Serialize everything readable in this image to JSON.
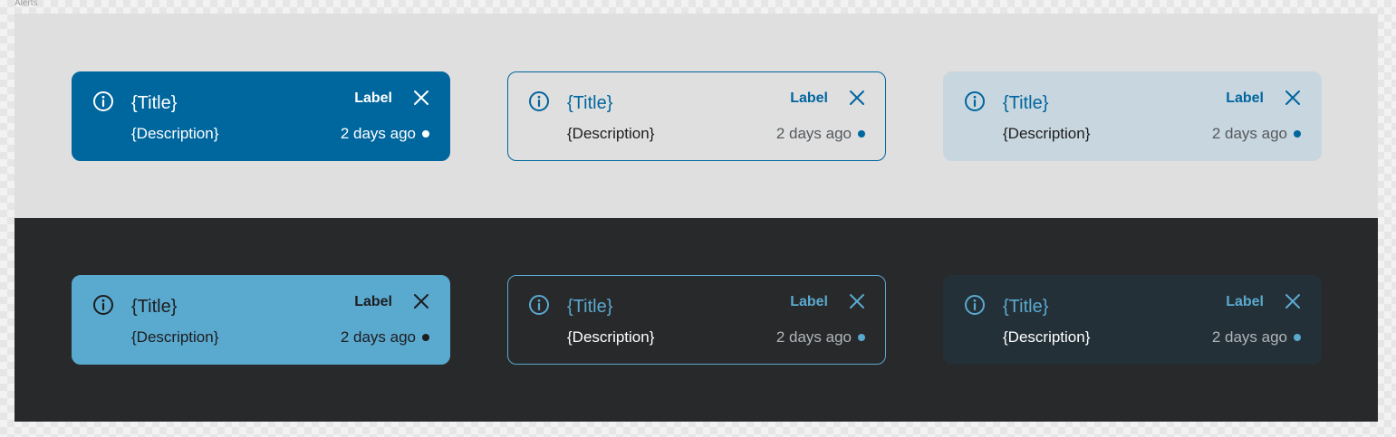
{
  "frame": {
    "label": "Alerts"
  },
  "colors": {
    "light_panel_bg": "#dfdfdf",
    "dark_panel_bg": "#28292b",
    "primary": "#00669e",
    "primary_light": "#5aa9cf",
    "tint_light": "#c8d6df",
    "tint_dark": "#243038",
    "text_dark": "#1d1d1f",
    "text_light": "#ffffff"
  },
  "alerts": {
    "light": [
      {
        "variant": "filled",
        "icon": "info-circle-icon",
        "title": "{Title}",
        "description": "{Description}",
        "label": "Label",
        "time": "2 days ago",
        "close_icon": "close-icon",
        "unread_indicator": "dot"
      },
      {
        "variant": "outlined",
        "icon": "info-circle-icon",
        "title": "{Title}",
        "description": "{Description}",
        "label": "Label",
        "time": "2 days ago",
        "close_icon": "close-icon",
        "unread_indicator": "dot"
      },
      {
        "variant": "tinted",
        "icon": "info-circle-icon",
        "title": "{Title}",
        "description": "{Description}",
        "label": "Label",
        "time": "2 days ago",
        "close_icon": "close-icon",
        "unread_indicator": "dot"
      }
    ],
    "dark": [
      {
        "variant": "filled",
        "icon": "info-circle-icon",
        "title": "{Title}",
        "description": "{Description}",
        "label": "Label",
        "time": "2 days ago",
        "close_icon": "close-icon",
        "unread_indicator": "dot"
      },
      {
        "variant": "outlined",
        "icon": "info-circle-icon",
        "title": "{Title}",
        "description": "{Description}",
        "label": "Label",
        "time": "2 days ago",
        "close_icon": "close-icon",
        "unread_indicator": "dot"
      },
      {
        "variant": "tinted",
        "icon": "info-circle-icon",
        "title": "{Title}",
        "description": "{Description}",
        "label": "Label",
        "time": "2 days ago",
        "close_icon": "close-icon",
        "unread_indicator": "dot"
      }
    ]
  }
}
